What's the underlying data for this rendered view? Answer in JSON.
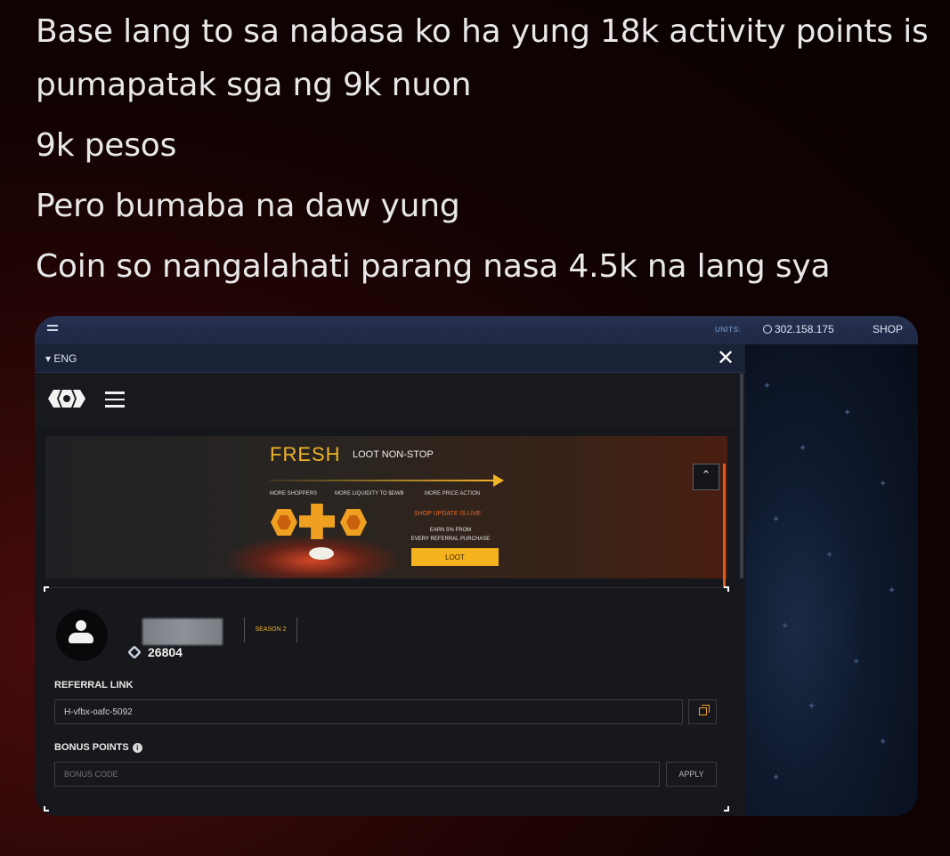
{
  "post": {
    "lines": [
      "Base lang to sa nabasa ko ha yung 18k activity points is pumapatak sga ng 9k nuon",
      "9k pesos",
      "Pero bumaba na daw yung",
      "Coin so nangalahati parang nasa 4.5k na lang sya"
    ],
    "partial_bottom": "... ... ... ... ... ... ..."
  },
  "screenshot": {
    "topbar": {
      "units_label": "UNITS:",
      "units_value": "302.158.175",
      "shop_label": "SHOP"
    },
    "panel": {
      "language": "▾ ENG",
      "close_glyph": "✕"
    },
    "banner": {
      "headline": "FRESH",
      "subheadline": "LOOT NON-STOP",
      "features": [
        "MORE SHOPPERS",
        "MORE LIQUIDITY TO $DWB",
        "MORE PRICE ACTION"
      ],
      "shop_update": "SHOP UPDATE IS LIVE",
      "earn_line1": "EARN 5% FROM",
      "earn_line2": "EVERY REFERRAL PURCHASE",
      "loot_button": "LOOT",
      "collapse_glyph": "⌃"
    },
    "profile": {
      "season": "SEASON 2",
      "points": "26804",
      "referral_label": "REFERRAL LINK",
      "referral_value": "H-vfbx-oafc-5092",
      "bonus_label": "BONUS POINTS",
      "bonus_info_glyph": "i",
      "bonus_placeholder": "BONUS CODE",
      "apply_button": "APPLY"
    }
  },
  "colors": {
    "accent_gold": "#f0b429",
    "accent_orange": "#e05a1a",
    "panel_bg": "#15171c",
    "topbar_bg": "#263150"
  }
}
